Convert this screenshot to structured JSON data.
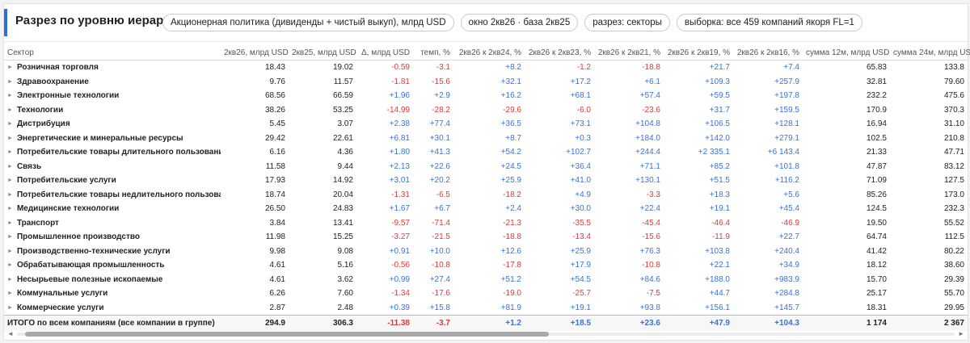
{
  "header": {
    "title": "Разрез по уровню иерархии",
    "pills": [
      "Акционерная политика (дивиденды + чистый выкуп), млрд USD",
      "окно 2кв26 · база 2кв25",
      "разрез: секторы",
      "выборка: все 459 компаний якоря FL=1"
    ]
  },
  "table": {
    "columns": [
      "Сектор",
      "2кв26, млрд USD",
      "2кв25, млрд USD",
      "Δ, млрд USD",
      "темп, %",
      "2кв26 к 2кв24, %",
      "2кв26 к 2кв23, %",
      "2кв26 к 2кв21, %",
      "2кв26 к 2кв19, %",
      "2кв26 к 2кв16, %",
      "сумма 12м, млрд USD",
      "сумма 24м, млрд USD"
    ],
    "rows": [
      [
        "Розничная торговля",
        "18.43",
        "19.02",
        "-0.59",
        "-3.1",
        "+8.2",
        "-1.2",
        "-18.8",
        "+21.7",
        "+7.4",
        "65.83",
        "133.8"
      ],
      [
        "Здравоохранение",
        "9.76",
        "11.57",
        "-1.81",
        "-15.6",
        "+32.1",
        "+17.2",
        "+6.1",
        "+109.3",
        "+257.9",
        "32.81",
        "79.60"
      ],
      [
        "Электронные технологии",
        "68.56",
        "66.59",
        "+1.96",
        "+2.9",
        "+16.2",
        "+68.1",
        "+57.4",
        "+59.5",
        "+197.8",
        "232.2",
        "475.6"
      ],
      [
        "Технологии",
        "38.26",
        "53.25",
        "-14.99",
        "-28.2",
        "-29.6",
        "-6.0",
        "-23.6",
        "+31.7",
        "+159.5",
        "170.9",
        "370.3"
      ],
      [
        "Дистрибуция",
        "5.45",
        "3.07",
        "+2.38",
        "+77.4",
        "+36.5",
        "+73.1",
        "+104.8",
        "+106.5",
        "+128.1",
        "16.94",
        "31.10"
      ],
      [
        "Энергетические и минеральные ресурсы",
        "29.42",
        "22.61",
        "+6.81",
        "+30.1",
        "+8.7",
        "+0.3",
        "+184.0",
        "+142.0",
        "+279.1",
        "102.5",
        "210.8"
      ],
      [
        "Потребительские товары длительного пользования",
        "6.16",
        "4.36",
        "+1.80",
        "+41.3",
        "+54.2",
        "+102.7",
        "+244.4",
        "+2 335.1",
        "+6 143.4",
        "21.33",
        "47.71"
      ],
      [
        "Связь",
        "11.58",
        "9.44",
        "+2.13",
        "+22.6",
        "+24.5",
        "+36.4",
        "+71.1",
        "+85.2",
        "+101.8",
        "47.87",
        "83.12"
      ],
      [
        "Потребительские услуги",
        "17.93",
        "14.92",
        "+3.01",
        "+20.2",
        "+25.9",
        "+41.0",
        "+130.1",
        "+51.5",
        "+116.2",
        "71.09",
        "127.5"
      ],
      [
        "Потребительские товары недлительного пользования",
        "18.74",
        "20.04",
        "-1.31",
        "-6.5",
        "-18.2",
        "+4.9",
        "-3.3",
        "+18.3",
        "+5.6",
        "85.26",
        "173.0"
      ],
      [
        "Медицинские технологии",
        "26.50",
        "24.83",
        "+1.67",
        "+6.7",
        "+2.4",
        "+30.0",
        "+22.4",
        "+19.1",
        "+45.4",
        "124.5",
        "232.3"
      ],
      [
        "Транспорт",
        "3.84",
        "13.41",
        "-9.57",
        "-71.4",
        "-21.3",
        "-35.5",
        "-45.4",
        "-46.4",
        "-46.9",
        "19.50",
        "55.52"
      ],
      [
        "Промышленное производство",
        "11.98",
        "15.25",
        "-3.27",
        "-21.5",
        "-18.8",
        "-13.4",
        "-15.6",
        "-11.9",
        "+22.7",
        "64.74",
        "112.5"
      ],
      [
        "Производственно-технические услуги",
        "9.98",
        "9.08",
        "+0.91",
        "+10.0",
        "+12.6",
        "+25.9",
        "+76.3",
        "+103.8",
        "+240.4",
        "41.42",
        "80.22"
      ],
      [
        "Обрабатывающая промышленность",
        "4.61",
        "5.16",
        "-0.56",
        "-10.8",
        "-17.8",
        "+17.9",
        "-10.8",
        "+22.1",
        "+34.9",
        "18.12",
        "38.60"
      ],
      [
        "Несырьевые полезные ископаемые",
        "4.61",
        "3.62",
        "+0.99",
        "+27.4",
        "+51.2",
        "+54.5",
        "+84.6",
        "+188.0",
        "+983.9",
        "15.70",
        "29.39"
      ],
      [
        "Коммунальные услуги",
        "6.26",
        "7.60",
        "-1.34",
        "-17.6",
        "-19.0",
        "-25.7",
        "-7.5",
        "+44.7",
        "+284.8",
        "25.17",
        "55.70"
      ],
      [
        "Коммерческие услуги",
        "2.87",
        "2.48",
        "+0.39",
        "+15.8",
        "+81.9",
        "+19.1",
        "+93.8",
        "+156.1",
        "+145.7",
        "18.31",
        "29.95"
      ]
    ],
    "total": [
      "ИТОГО по всем компаниям (все компании в группе)",
      "294.9",
      "306.3",
      "-11.38",
      "-3.7",
      "+1.2",
      "+18.5",
      "+23.6",
      "+47.9",
      "+104.3",
      "1 174",
      "2 367"
    ],
    "expand_glyph": "►"
  },
  "colors": {
    "accent": "#2f6fdb",
    "negative": "#e03b3b",
    "positive": "#3a72d6"
  },
  "scrollbar": {
    "left_arrow": "◄",
    "right_arrow": "►"
  }
}
